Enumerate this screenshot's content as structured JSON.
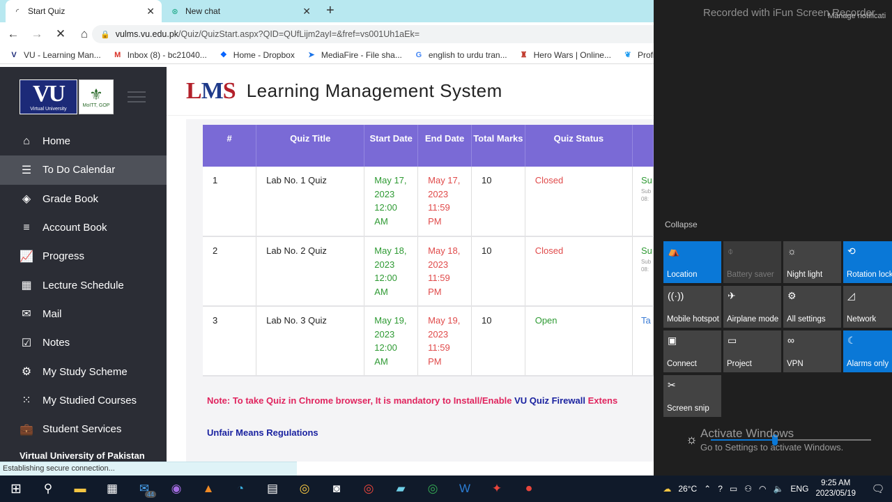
{
  "browser": {
    "tabs": [
      {
        "title": "Start Quiz",
        "active": true
      },
      {
        "title": "New chat",
        "active": false
      }
    ],
    "url_host": "vulms.vu.edu.pk",
    "url_path": "/Quiz/QuizStart.aspx?QID=QUfLijm2ayI=&fref=vs001Uh1aEk=",
    "bookmarks": [
      {
        "label": "VU - Learning Man...",
        "icon": "vu-icon"
      },
      {
        "label": "Inbox (8) - bc21040...",
        "icon": "gmail-icon"
      },
      {
        "label": "Home - Dropbox",
        "icon": "dropbox-icon"
      },
      {
        "label": "MediaFire - File sha...",
        "icon": "mediafire-icon"
      },
      {
        "label": "english to urdu tran...",
        "icon": "google-icon"
      },
      {
        "label": "Hero Wars | Online...",
        "icon": "herowars-icon"
      },
      {
        "label": "Profile / Twitter",
        "icon": "twitter-icon"
      }
    ],
    "status_text": "Establishing secure connection..."
  },
  "sidebar": {
    "vu_logo_text": "VU",
    "vu_logo_sub": "Virtual University",
    "gop_logo_sub": "MoITT, GOP",
    "items": [
      {
        "label": "Home",
        "icon": "home-icon"
      },
      {
        "label": "To Do Calendar",
        "icon": "list-icon",
        "selected": true
      },
      {
        "label": "Grade Book",
        "icon": "layers-icon"
      },
      {
        "label": "Account Book",
        "icon": "sliders-icon"
      },
      {
        "label": "Progress",
        "icon": "chart-icon"
      },
      {
        "label": "Lecture Schedule",
        "icon": "calendar-icon"
      },
      {
        "label": "Mail",
        "icon": "mail-icon"
      },
      {
        "label": "Notes",
        "icon": "checklist-icon"
      },
      {
        "label": "My Study Scheme",
        "icon": "gear-icon"
      },
      {
        "label": "My Studied Courses",
        "icon": "grid-icon"
      },
      {
        "label": "Student Services",
        "icon": "briefcase-icon"
      }
    ],
    "footer": "Virtual University of Pakistan"
  },
  "header": {
    "logo_l": "L",
    "logo_m": "M",
    "logo_s": "S",
    "title": "Learning Management System"
  },
  "quiz_table": {
    "headers": [
      "#",
      "Quiz Title",
      "Start Date",
      "End Date",
      "Total Marks",
      "Quiz Status"
    ],
    "rows": [
      {
        "num": "1",
        "title": "Lab No. 1 Quiz",
        "start": "May 17, 2023 12:00 AM",
        "end": "May 17, 2023 11:59 PM",
        "marks": "10",
        "status": "Closed",
        "status_color": "#e04a4a",
        "extra": "Su",
        "extra_sub1": "Sub",
        "extra_sub2": "08:"
      },
      {
        "num": "2",
        "title": "Lab No. 2 Quiz",
        "start": "May 18, 2023 12:00 AM",
        "end": "May 18, 2023 11:59 PM",
        "marks": "10",
        "status": "Closed",
        "status_color": "#e04a4a",
        "extra": "Su",
        "extra_sub1": "Sub",
        "extra_sub2": "08:"
      },
      {
        "num": "3",
        "title": "Lab No. 3 Quiz",
        "start": "May 19, 2023 12:00 AM",
        "end": "May 19, 2023 11:59 PM",
        "marks": "10",
        "status": "Open",
        "status_color": "#2e9a33",
        "extra": "Ta",
        "extra_sub1": "",
        "extra_sub2": ""
      }
    ]
  },
  "note": {
    "prefix": "Note: To take Quiz in Chrome browser, It is mandatory to Install/Enable ",
    "firewall": "VU Quiz Firewall",
    "suffix": " Extens"
  },
  "unfair_means": "Unfair Means Regulations",
  "action_center": {
    "watermark": "Recorded with iFun Screen Recorder",
    "manage": "Manage notificati",
    "collapse": "Collapse",
    "tiles": [
      {
        "label": "Location",
        "state": "on",
        "icon": "person-pin-icon"
      },
      {
        "label": "Battery saver",
        "state": "disabled",
        "icon": "battery-saver-icon"
      },
      {
        "label": "Night light",
        "state": "off",
        "icon": "sun-icon"
      },
      {
        "label": "Rotation lock",
        "state": "on",
        "icon": "rotation-lock-icon"
      },
      {
        "label": "Mobile hotspot",
        "state": "off",
        "icon": "hotspot-icon"
      },
      {
        "label": "Airplane mode",
        "state": "off",
        "icon": "airplane-icon"
      },
      {
        "label": "All settings",
        "state": "off",
        "icon": "gear-icon"
      },
      {
        "label": "Network",
        "state": "off",
        "icon": "network-icon"
      },
      {
        "label": "Connect",
        "state": "off",
        "icon": "connect-icon"
      },
      {
        "label": "Project",
        "state": "off",
        "icon": "project-icon"
      },
      {
        "label": "VPN",
        "state": "off",
        "icon": "vpn-icon"
      },
      {
        "label": "Alarms only",
        "state": "on",
        "icon": "moon-icon"
      },
      {
        "label": "Screen snip",
        "state": "off",
        "icon": "snip-icon"
      }
    ],
    "brightness_percent": 40,
    "activate_title": "Activate Windows",
    "activate_sub": "Go to Settings to activate Windows."
  },
  "taskbar": {
    "mail_badge": "44",
    "weather": "26°C",
    "language": "ENG",
    "time": "9:25 AM",
    "date": "2023/05/19"
  }
}
